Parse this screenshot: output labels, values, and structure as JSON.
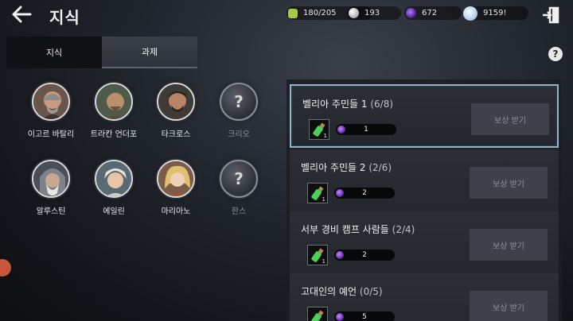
{
  "header": {
    "title": "지식",
    "resources": {
      "energy": "180/205",
      "pearl": "193",
      "dark_spirit": "672",
      "silver": "9159!"
    }
  },
  "tabs": [
    {
      "label": "지식"
    },
    {
      "label": "과제"
    }
  ],
  "help_label": "?",
  "characters": [
    {
      "name": "이고르 바탈리",
      "locked": false
    },
    {
      "name": "트라칸 언더포",
      "locked": false
    },
    {
      "name": "타크로스",
      "locked": false
    },
    {
      "name": "크리오",
      "locked": true
    },
    {
      "name": "알루스틴",
      "locked": false
    },
    {
      "name": "에일린",
      "locked": false
    },
    {
      "name": "마리아노",
      "locked": false
    },
    {
      "name": "한스",
      "locked": true
    }
  ],
  "locked_mark": "?",
  "quests": [
    {
      "title": "벨리아 주민들 1",
      "progress": "(6/8)",
      "reward_count": "1",
      "reward_value": "1",
      "button": "보상 받기"
    },
    {
      "title": "벨리아 주민들 2",
      "progress": "(2/6)",
      "reward_count": "1",
      "reward_value": "2",
      "button": "보상 받기"
    },
    {
      "title": "서부 경비 캠프 사람들",
      "progress": "(2/4)",
      "reward_count": "1",
      "reward_value": "2",
      "button": "보상 받기"
    },
    {
      "title": "고대인의 예언",
      "progress": "(0/5)",
      "reward_count": "1",
      "reward_value": "5",
      "button": "보상 받기"
    }
  ],
  "colors": {
    "accent_border": "#8fb3c9",
    "dark_spirit": "#7b3fd0",
    "energy": "#a8c84a"
  }
}
